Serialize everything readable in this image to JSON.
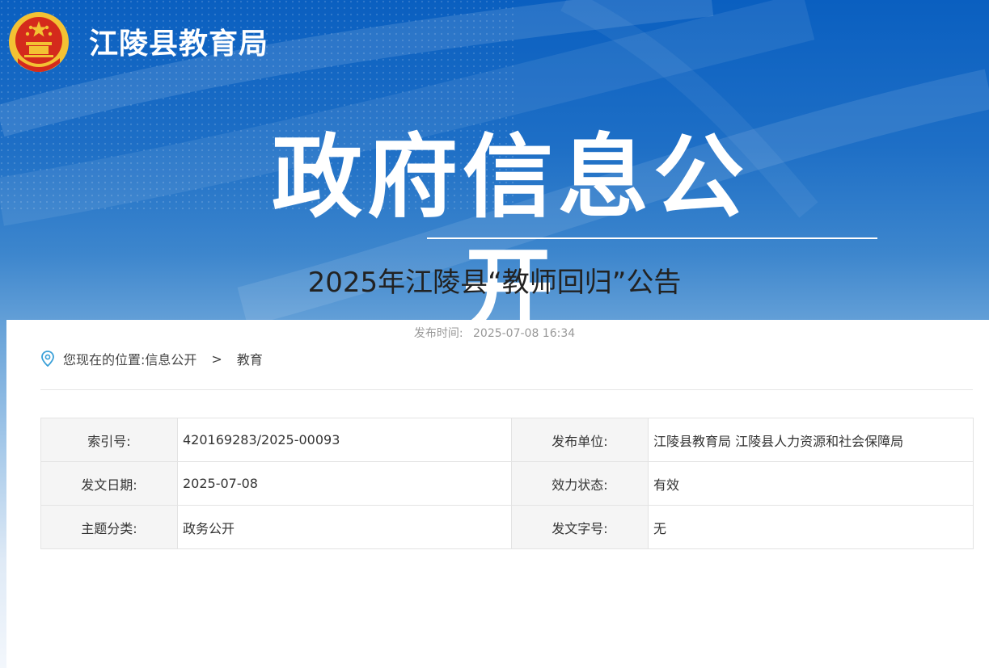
{
  "site": {
    "name": "江陵县教育局",
    "emblem_icon": "national-emblem-icon"
  },
  "hero": {
    "title": "政府信息公开"
  },
  "breadcrumb": {
    "prefix": "您现在的位置:",
    "items": [
      "信息公开",
      "教育"
    ],
    "separator": ">",
    "icon": "location-pin-icon"
  },
  "meta": {
    "rows": [
      {
        "label_left": "索引号:",
        "value_left": "420169283/2025-00093",
        "label_right": "发布单位:",
        "value_right": "江陵县教育局 江陵县人力资源和社会保障局"
      },
      {
        "label_left": "发文日期:",
        "value_left": "2025-07-08",
        "label_right": "效力状态:",
        "value_right": "有效"
      },
      {
        "label_left": "主题分类:",
        "value_left": "政务公开",
        "label_right": "发文字号:",
        "value_right": "无"
      }
    ]
  },
  "article": {
    "title": "2025年江陵县“教师回归”公告",
    "publish_label": "发布时间:",
    "publish_time": "2025-07-08 16:34"
  },
  "colors": {
    "banner_top": "#0a5fc0",
    "banner_bottom": "#f3f7fc",
    "emblem_red": "#d42a1c",
    "emblem_gold": "#f3c233"
  }
}
